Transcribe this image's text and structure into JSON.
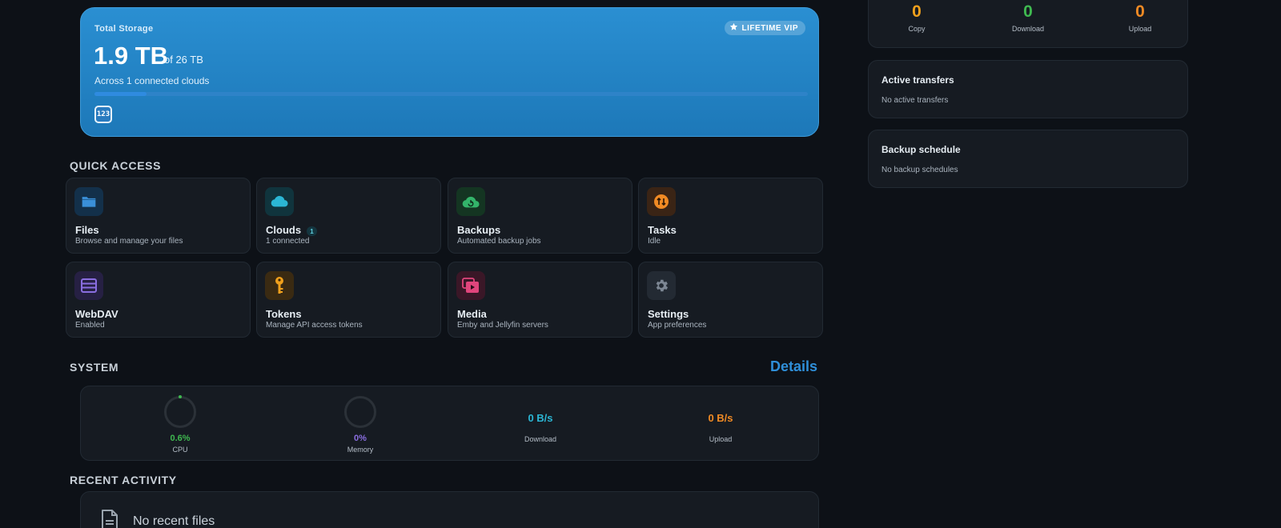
{
  "storage": {
    "label": "Total Storage",
    "used": "1.9 TB",
    "total": "of 26 TB",
    "subtitle": "Across 1 connected clouds",
    "badge": "LIFETIME VIP",
    "usage_fraction": 0.073,
    "cloud_chip": "123"
  },
  "quick_access": {
    "title": "QUICK ACCESS",
    "tiles": [
      {
        "name": "Files",
        "desc": "Browse and manage your files",
        "icon": "folder-icon",
        "color": "#3a8fd8"
      },
      {
        "name": "Clouds",
        "desc": "1 connected",
        "icon": "cloud-icon",
        "color": "#2bb6d4",
        "count": "1"
      },
      {
        "name": "Backups",
        "desc": "Automated backup jobs",
        "icon": "cloud-sync-icon",
        "color": "#33b46a"
      },
      {
        "name": "Tasks",
        "desc": "Idle",
        "icon": "transfer-arrows-icon",
        "color": "#f08a24"
      },
      {
        "name": "WebDAV",
        "desc": "Enabled",
        "icon": "server-icon",
        "color": "#8a6ee0"
      },
      {
        "name": "Tokens",
        "desc": "Manage API access tokens",
        "icon": "key-icon",
        "color": "#f0a01c"
      },
      {
        "name": "Media",
        "desc": "Emby and Jellyfin servers",
        "icon": "media-play-icon",
        "color": "#e0457c"
      },
      {
        "name": "Settings",
        "desc": "App preferences",
        "icon": "gear-icon",
        "color": "#7d8794"
      }
    ]
  },
  "system": {
    "title": "SYSTEM",
    "details_label": "Details",
    "cpu": {
      "value": "0.6%",
      "label": "CPU",
      "color": "#3fb950",
      "fraction": 0.006
    },
    "memory": {
      "value": "0%",
      "label": "Memory",
      "color": "#8a6ee0",
      "fraction": 0
    },
    "download": {
      "value": "0 B/s",
      "label": "Download",
      "color": "#2bb6d4"
    },
    "upload": {
      "value": "0 B/s",
      "label": "Upload",
      "color": "#f08a24"
    }
  },
  "recent": {
    "title": "RECENT ACTIVITY",
    "empty_text": "No recent files"
  },
  "counters": [
    {
      "value": "0",
      "label": "Copy",
      "color": "#f0a01c"
    },
    {
      "value": "0",
      "label": "Download",
      "color": "#3fb950"
    },
    {
      "value": "0",
      "label": "Upload",
      "color": "#f08a24"
    }
  ],
  "active_transfers": {
    "title": "Active transfers",
    "empty": "No active transfers"
  },
  "backup_schedule": {
    "title": "Backup schedule",
    "empty": "No backup schedules"
  }
}
